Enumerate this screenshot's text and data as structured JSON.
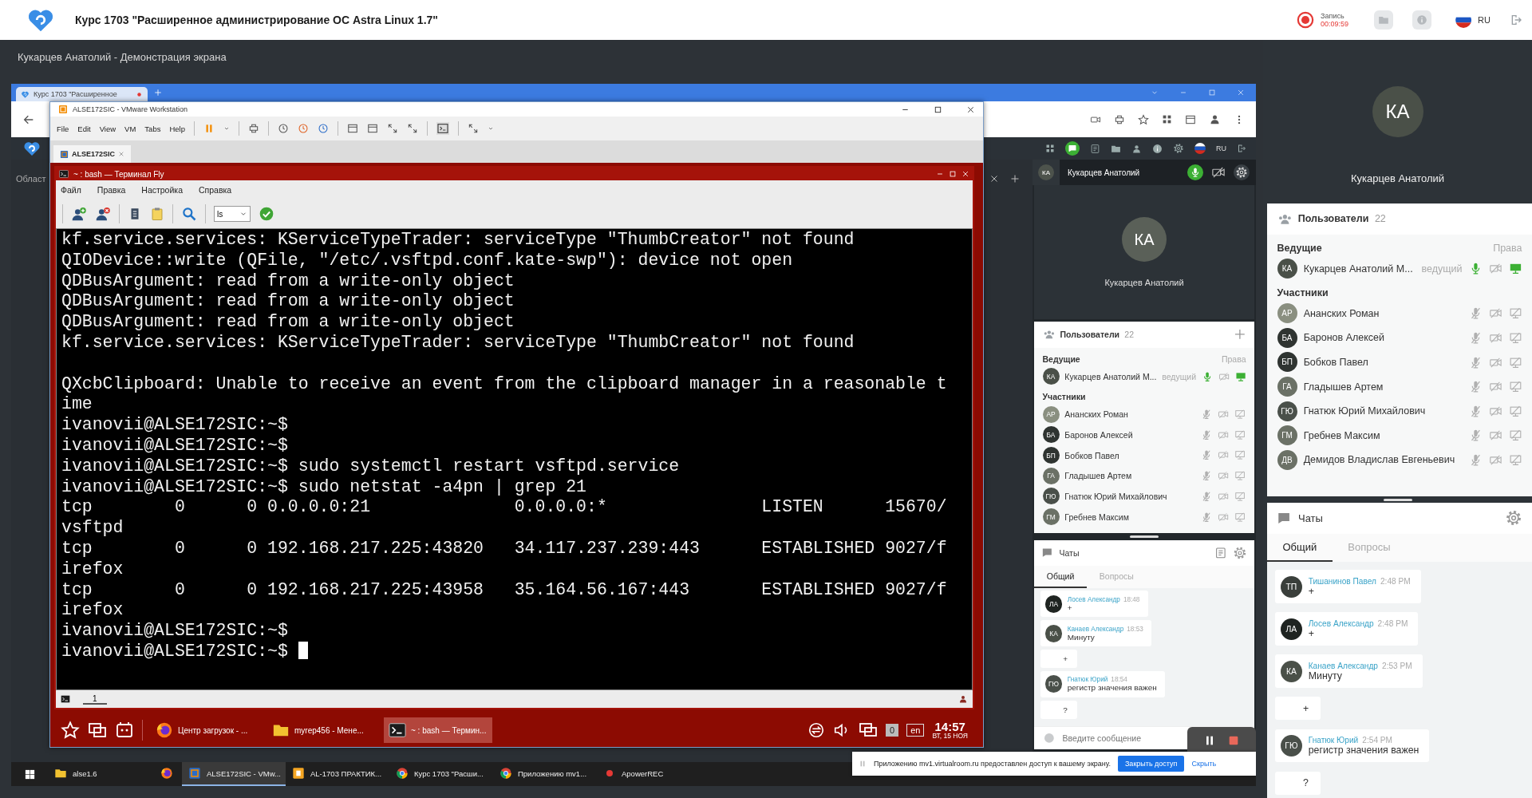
{
  "app": {
    "title": "Курс 1703 \"Расширенное администрирование ОС Astra Linux 1.7\"",
    "record_label": "Запись",
    "record_time": "00:09:59",
    "language": "RU"
  },
  "share": {
    "title": "Кукарцев Анатолий - Демонстрация экрана"
  },
  "screen": {
    "browser": {
      "tab": "Курс 1703 \"Расширенное",
      "page_label": "Област",
      "language": "RU"
    },
    "vmware": {
      "title": "ALSE172SIC - VMware Workstation",
      "menu": [
        "File",
        "Edit",
        "View",
        "VM",
        "Tabs",
        "Help"
      ],
      "tab": "ALSE172SIC"
    },
    "terminal": {
      "title": "~ : bash — Терминал Fly",
      "menu": [
        "Файл",
        "Правка",
        "Настройка",
        "Справка"
      ],
      "command": "ls",
      "tab": "1",
      "lines": [
        {
          "text": "kf.service.services: KServiceTypeTrader: serviceType \"ThumbCreator\" not found"
        },
        {
          "text": "QIODevice::write (QFile, \"/etc/.vsftpd.conf.kate-swp\"): device not open"
        },
        {
          "text": "QDBusArgument: read from a write-only object"
        },
        {
          "text": "QDBusArgument: read from a write-only object"
        },
        {
          "text": "QDBusArgument: read from a write-only object"
        },
        {
          "text": "kf.service.services: KServiceTypeTrader: serviceType \"ThumbCreator\" not found"
        },
        {
          "text": "QXcbClipboard: Unable to receive an event from the clipboard manager in a reasonable t",
          "blank_before": true
        },
        {
          "text": "ime"
        },
        {
          "text": "ivanovii@ALSE172SIC:~$"
        },
        {
          "text": "ivanovii@ALSE172SIC:~$"
        },
        {
          "text": "ivanovii@ALSE172SIC:~$ sudo systemctl restart vsftpd.service"
        },
        {
          "text": "ivanovii@ALSE172SIC:~$ sudo netstat -a4pn | grep 21"
        },
        {
          "text": "tcp        0      0 0.0.0.0:21              0.0.0.0:*               LISTEN      15670/"
        },
        {
          "text": "vsftpd"
        },
        {
          "text": "tcp        0      0 192.168.217.225:43820   34.117.237.239:443      ESTABLISHED 9027/f"
        },
        {
          "text": "irefox"
        },
        {
          "text": "tcp        0      0 192.168.217.225:43958   35.164.56.167:443       ESTABLISHED 9027/f"
        },
        {
          "text": "irefox"
        },
        {
          "text": "ivanovii@ALSE172SIC:~$"
        },
        {
          "text": "ivanovii@ALSE172SIC:~$",
          "cursor": true
        }
      ]
    },
    "fly_taskbar": {
      "tasks": [
        {
          "kind": "firefox",
          "label": "Центр загрузок - ...",
          "selected": false
        },
        {
          "kind": "folder",
          "label": "myrep456 - Мене...",
          "selected": false
        },
        {
          "kind": "terminal",
          "label": "~ : bash — Термин...",
          "selected": true
        }
      ],
      "indicator": "0",
      "layout": "en",
      "time": "14:57",
      "date": "ВТ, 15 НОЯ"
    },
    "conference": {
      "header": {
        "initials": "КА",
        "name": "Кукарцев Анатолий",
        "mic_on": true
      },
      "tile": {
        "initials": "КА",
        "name": "Кукарцев Анатолий"
      },
      "users": {
        "title": "Пользователи",
        "count": "22",
        "hosts_label": "Ведущие",
        "rights_label": "Права",
        "participants_label": "Участники",
        "hosts": [
          {
            "initials": "КА",
            "name": "Кукарцев Анатолий М...",
            "role": "ведущий",
            "color": "#4a5048",
            "mic_on": true,
            "camera_on": false,
            "screen_on": true
          }
        ],
        "participants": [
          {
            "initials": "АР",
            "name": "Ананских Роман",
            "color": "#8a8f80",
            "mic_on": false,
            "camera_on": false,
            "screen_on": false
          },
          {
            "initials": "БА",
            "name": "Баронов Алексей",
            "color": "#2f3431",
            "mic_on": false,
            "camera_on": false,
            "screen_on": false
          },
          {
            "initials": "БП",
            "name": "Бобков Павел",
            "color": "#2f3431",
            "mic_on": false,
            "camera_on": false,
            "screen_on": false
          },
          {
            "initials": "ГА",
            "name": "Гладышев Артем",
            "color": "#6b7166",
            "mic_on": false,
            "camera_on": false,
            "screen_on": false
          },
          {
            "initials": "ГЮ",
            "name": "Гнатюк Юрий Михайлович",
            "color": "#4a504a",
            "mic_on": false,
            "camera_on": false,
            "screen_on": false
          },
          {
            "initials": "ГМ",
            "name": "Гребнев Максим",
            "color": "#6b7166",
            "mic_on": false,
            "camera_on": false,
            "screen_on": false
          }
        ]
      },
      "chat": {
        "title": "Чаты",
        "tabs": [
          {
            "label": "Общий",
            "selected": true
          },
          {
            "label": "Вопросы",
            "selected": false
          }
        ],
        "messages": [
          {
            "kind": "message",
            "initials": "ЛА",
            "color": "#1f2421",
            "author": "Лосев Александр",
            "time": "18:48",
            "text": "+"
          },
          {
            "kind": "message",
            "initials": "КА",
            "color": "#4a5048",
            "author": "Канаев Александр",
            "time": "18:53",
            "text": "Минуту"
          },
          {
            "kind": "continuation",
            "text": "+"
          },
          {
            "kind": "message",
            "initials": "ГЮ",
            "color": "#4a504a",
            "author": "Гнатюк Юрий",
            "time": "18:54",
            "text": "регистр значения важен"
          },
          {
            "kind": "continuation",
            "text": "?"
          }
        ],
        "placeholder": "Введите сообщение"
      }
    },
    "notification": {
      "text": "Приложению mv1.virtualroom.ru предоставлен доступ к вашему экрану.",
      "button": "Закрыть доступ",
      "link": "Скрыть"
    },
    "taskbar": {
      "items": [
        {
          "kind": "folder",
          "label": "alse1.6",
          "selected": false
        },
        {
          "kind": "firefox",
          "selected": false
        },
        {
          "kind": "vmware",
          "label": "ALSE172SIC - VMw...",
          "selected": true
        },
        {
          "kind": "document",
          "label": "AL-1703 ПРАКТИК...",
          "selected": false
        },
        {
          "kind": "chrome",
          "label": "Курс 1703 \"Расши...",
          "selected": false
        },
        {
          "kind": "chrome",
          "label": "Приложению mv1...",
          "selected": false
        },
        {
          "kind": "recorder",
          "label": "ApowerREC",
          "selected": false
        }
      ]
    }
  },
  "sidebar": {
    "presenter": {
      "initials": "КА",
      "name": "Кукарцев Анатолий"
    },
    "users": {
      "title": "Пользователи",
      "count": "22",
      "hosts_label": "Ведущие",
      "rights_label": "Права",
      "participants_label": "Участники",
      "hosts": [
        {
          "initials": "КА",
          "name": "Кукарцев Анатолий М...",
          "role": "ведущий",
          "color": "#4a5048",
          "mic_on": true,
          "camera_on": false,
          "screen_on": true
        }
      ],
      "participants": [
        {
          "initials": "АР",
          "name": "Ананских Роман",
          "color": "#8a8f80",
          "mic_on": false,
          "camera_on": false,
          "screen_on": false
        },
        {
          "initials": "БА",
          "name": "Баронов Алексей",
          "color": "#2f3431",
          "mic_on": false,
          "camera_on": false,
          "screen_on": false
        },
        {
          "initials": "БП",
          "name": "Бобков Павел",
          "color": "#2f3431",
          "mic_on": false,
          "camera_on": false,
          "screen_on": false
        },
        {
          "initials": "ГА",
          "name": "Гладышев Артем",
          "color": "#6b7166",
          "mic_on": false,
          "camera_on": false,
          "screen_on": false
        },
        {
          "initials": "ГЮ",
          "name": "Гнатюк Юрий Михайлович",
          "color": "#4a504a",
          "mic_on": false,
          "camera_on": false,
          "screen_on": false
        },
        {
          "initials": "ГМ",
          "name": "Гребнев Максим",
          "color": "#6b7166",
          "mic_on": false,
          "camera_on": false,
          "screen_on": false
        },
        {
          "initials": "ДВ",
          "name": "Демидов Владислав Евгеньевич",
          "color": "#6b7166",
          "mic_on": false,
          "camera_on": false,
          "screen_on": false
        }
      ]
    },
    "chat": {
      "title": "Чаты",
      "tabs": [
        {
          "label": "Общий",
          "selected": true
        },
        {
          "label": "Вопросы",
          "selected": false
        }
      ],
      "messages": [
        {
          "kind": "message",
          "initials": "ТП",
          "color": "#3a3f3b",
          "author": "Тишанинов Павел",
          "time": "2:48 PM",
          "text": "+"
        },
        {
          "kind": "message",
          "initials": "ЛА",
          "color": "#1f2421",
          "author": "Лосев Александр",
          "time": "2:48 PM",
          "text": "+"
        },
        {
          "kind": "message",
          "initials": "КА",
          "color": "#4a5048",
          "author": "Канаев Александр",
          "time": "2:53 PM",
          "text": "Минуту"
        },
        {
          "kind": "continuation",
          "text": "+"
        },
        {
          "kind": "message",
          "initials": "ГЮ",
          "color": "#4a504a",
          "author": "Гнатюк Юрий",
          "time": "2:54 PM",
          "text": "регистр значения важен"
        },
        {
          "kind": "continuation",
          "text": "?"
        }
      ]
    }
  }
}
